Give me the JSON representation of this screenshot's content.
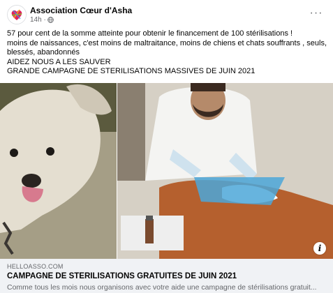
{
  "post": {
    "author": "Association Cœur d'Asha",
    "time": "14h ·",
    "more_label": "···",
    "audience_icon": "globe-icon",
    "text_lines": [
      "57 pour cent de la somme atteinte pour obtenir le financement de  100 stérilisations !",
      "moins de naissances, c'est moins de maltraitance, moins de chiens et chats souffrants , seuls, blessés, abandonnés",
      "AIDEZ NOUS A LES SAUVER",
      "GRANDE CAMPAGNE DE STERILISATIONS MASSIVES DE JUIN 2021"
    ]
  },
  "media": {
    "left_photo": "dog-on-chain-photo",
    "right_photo": "vet-surgery-photo",
    "info_label": "i"
  },
  "link_preview": {
    "domain": "HELLOASSO.COM",
    "title": "CAMPAGNE DE STERILISATIONS GRATUITES DE JUIN 2021",
    "description": "Comme tous les mois nous organisons avec votre aide une campagne de stérilisations gratuit..."
  }
}
